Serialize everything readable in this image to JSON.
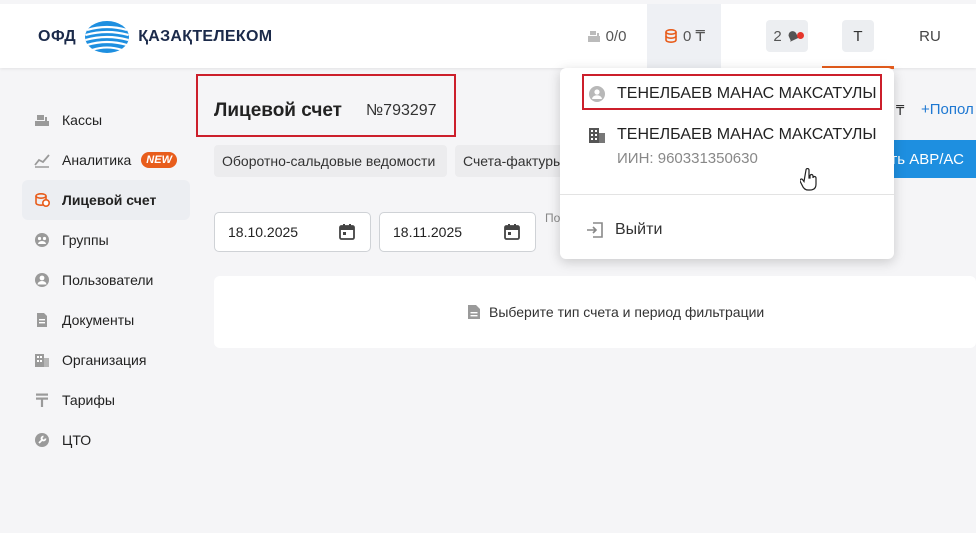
{
  "header": {
    "logo_left": "ОФД",
    "logo_right": "ҚАЗАҚТЕЛЕКОМ",
    "cash_count": "0/0",
    "balance": "0 ₸",
    "notifications": "2",
    "user_initial": "T",
    "language": "RU",
    "accent_color": "#e85d1c"
  },
  "sidebar": {
    "items": [
      {
        "label": "Кассы",
        "icon": "cash-register-icon"
      },
      {
        "label": "Аналитика",
        "icon": "chart-icon",
        "badge": "NEW"
      },
      {
        "label": "Лицевой счет",
        "icon": "coins-icon",
        "active": true
      },
      {
        "label": "Группы",
        "icon": "group-icon"
      },
      {
        "label": "Пользователи",
        "icon": "user-icon"
      },
      {
        "label": "Документы",
        "icon": "document-icon"
      },
      {
        "label": "Организация",
        "icon": "building-icon"
      },
      {
        "label": "Тарифы",
        "icon": "tenge-icon"
      },
      {
        "label": "ЦТО",
        "icon": "wrench-icon"
      }
    ]
  },
  "main": {
    "title": "Лицевой счет",
    "account_number": "№793297",
    "tabs": [
      "Оборотно-сальдовые ведомости",
      "Счета-фактуры"
    ],
    "right_currency": "₸",
    "right_link": "+Попол",
    "right_button": "ить АВР/АС",
    "date_from": "18.10.2025",
    "date_to": "18.11.2025",
    "period_label": "По",
    "empty_message": "Выберите тип счета и период фильтрации"
  },
  "dropdown": {
    "user_name": "ТЕНЕЛБАЕВ МАНАС МАКСАТУЛЫ",
    "org_name": "ТЕНЕЛБАЕВ МАНАС МАКСАТУЛЫ",
    "org_iin": "ИИН: 960331350630",
    "logout": "Выйти"
  }
}
